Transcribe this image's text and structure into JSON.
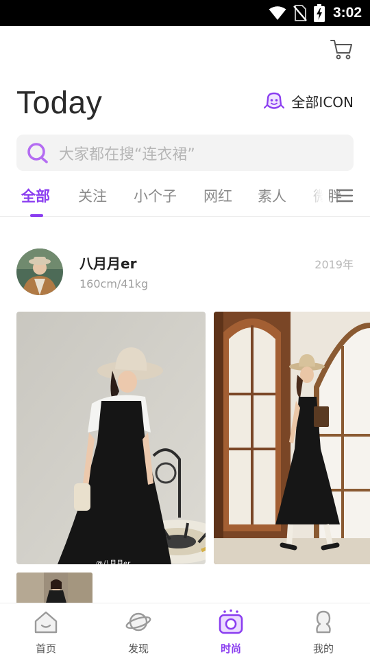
{
  "status_bar": {
    "time": "3:02",
    "icons": [
      "wifi-icon",
      "no-sim-icon",
      "battery-charging-icon"
    ]
  },
  "header": {
    "title": "Today",
    "cart_icon": "shopping-cart-icon",
    "all_icon_label": "全部ICON",
    "all_icon": "mascot-face-icon"
  },
  "search": {
    "placeholder": "大家都在搜“连衣裙”",
    "icon": "search-icon"
  },
  "tabs": [
    {
      "label": "全部",
      "active": true
    },
    {
      "label": "关注",
      "active": false
    },
    {
      "label": "小个子",
      "active": false
    },
    {
      "label": "网红",
      "active": false
    },
    {
      "label": "素人",
      "active": false
    },
    {
      "label": "微胖",
      "active": false
    }
  ],
  "post": {
    "user_name": "八月月er",
    "stats": "160cm/41kg",
    "year": "2019年",
    "watermark": "@八月月er"
  },
  "bottom_nav": [
    {
      "label": "首页",
      "icon": "home-icon",
      "active": false
    },
    {
      "label": "发现",
      "icon": "planet-icon",
      "active": false
    },
    {
      "label": "时尚",
      "icon": "camera-icon",
      "active": true
    },
    {
      "label": "我的",
      "icon": "profile-icon",
      "active": false
    }
  ],
  "colors": {
    "accent": "#8a3df0",
    "status_bar": "#000000",
    "inactive_text": "#8a8a8a",
    "search_bg": "#f3f3f3"
  }
}
